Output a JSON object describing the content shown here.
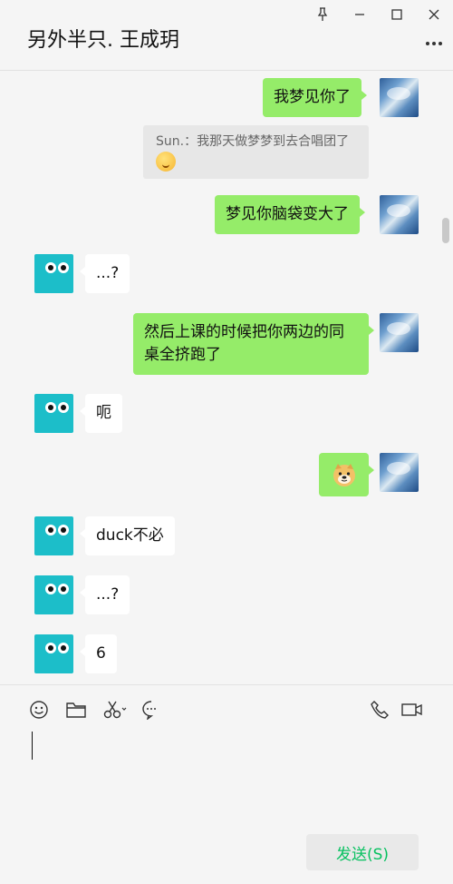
{
  "header": {
    "title": "另外半只. 王成玥"
  },
  "messages": [
    {
      "text": "我梦见你了"
    },
    {
      "quote": "Sun.：我那天做梦梦到去合唱团了"
    },
    {
      "text": "梦见你脑袋变大了"
    },
    {
      "text": "...?"
    },
    {
      "text": "然后上课的时候把你两边的同桌全挤跑了"
    },
    {
      "text": "呃"
    },
    {
      "text": "duck不必"
    },
    {
      "text": "...?"
    },
    {
      "text": "6"
    }
  ],
  "composer": {
    "send_label": "发送(S)"
  },
  "colors": {
    "my_bubble": "#95ec69",
    "other_bubble": "#ffffff",
    "send_text": "#07c160",
    "avatar_other": "#1cbec9"
  },
  "icons": [
    "pin-icon",
    "minimize-icon",
    "maximize-icon",
    "close-icon",
    "more-icon",
    "emoji-icon",
    "folder-icon",
    "scissors-icon",
    "chat-icon",
    "phone-icon",
    "video-icon"
  ]
}
